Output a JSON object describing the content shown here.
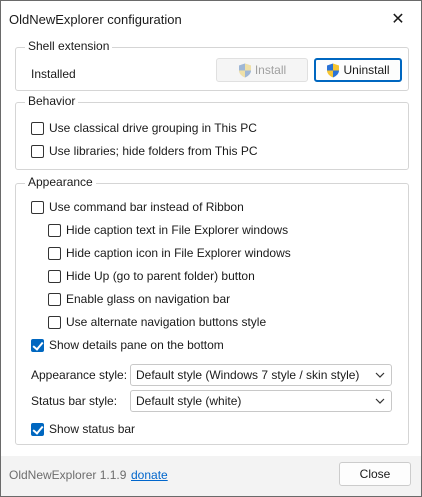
{
  "window": {
    "title": "OldNewExplorer configuration",
    "close_glyph": "✕"
  },
  "shell_extension": {
    "title": "Shell extension",
    "status": "Installed",
    "install_label": "Install",
    "uninstall_label": "Uninstall",
    "install_enabled": false
  },
  "behavior": {
    "title": "Behavior",
    "options": [
      {
        "label": "Use classical drive grouping in This PC",
        "checked": false
      },
      {
        "label": "Use libraries; hide folders from This PC",
        "checked": false
      }
    ]
  },
  "appearance": {
    "title": "Appearance",
    "use_command_bar": {
      "label": "Use command bar instead of Ribbon",
      "checked": false
    },
    "sub_options": [
      {
        "label": "Hide caption text in File Explorer windows",
        "checked": false
      },
      {
        "label": "Hide caption icon in File Explorer windows",
        "checked": false
      },
      {
        "label": "Hide Up (go to parent folder) button",
        "checked": false
      },
      {
        "label": "Enable glass on navigation bar",
        "checked": false
      },
      {
        "label": "Use alternate navigation buttons style",
        "checked": false
      }
    ],
    "show_details_pane": {
      "label": "Show details pane on the bottom",
      "checked": true
    },
    "appearance_style": {
      "label": "Appearance style:",
      "value": "Default style (Windows 7 style / skin style)"
    },
    "status_bar_style": {
      "label": "Status bar style:",
      "value": "Default style (white)"
    },
    "show_status_bar": {
      "label": "Show status bar",
      "checked": true
    }
  },
  "footer": {
    "version": "OldNewExplorer 1.1.9",
    "donate": "donate",
    "close_label": "Close"
  },
  "colors": {
    "accent": "#0067c0",
    "link": "#0066cc",
    "shield_blue": "#2b73d6",
    "shield_yellow": "#f7c531"
  },
  "icons": [
    "close-icon",
    "uac-shield-icon",
    "chevron-down-icon",
    "checkmark-icon"
  ]
}
